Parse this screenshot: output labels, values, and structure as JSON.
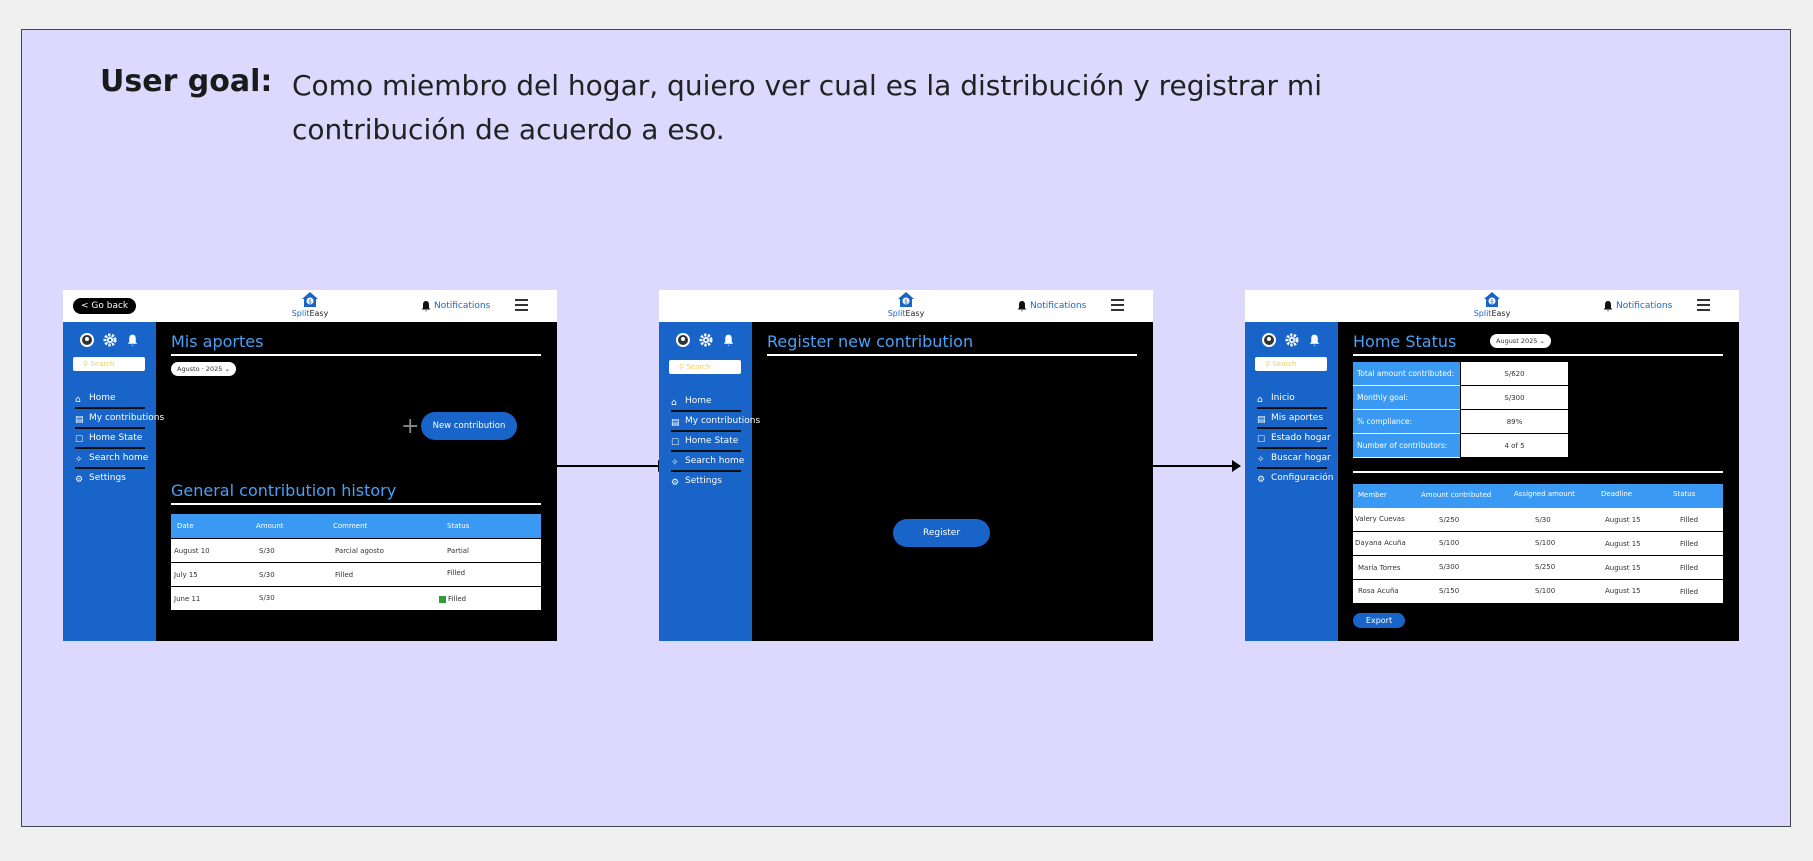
{
  "goal": {
    "label": "User goal:",
    "text": "Como miembro del hogar, quiero ver cual es la distribución y registrar mi contribución de acuerdo a eso."
  },
  "common": {
    "logo_a": "Split",
    "logo_b": "Easy",
    "notifications": "Notifications",
    "brand_blue": "#1864c8",
    "header_blue": "#3a99f2",
    "background": "#ddd8fd"
  },
  "screen1": {
    "go_back": "< Go back",
    "search_placeholder": "Search",
    "nav": [
      "Home",
      "My contributions",
      "Home State",
      "Search home",
      "Settings"
    ],
    "title": "Mis aportes",
    "month_selector": "Agusto · 2025",
    "new_contribution": "New contribution",
    "history_title": "General contribution history",
    "table": {
      "headers": [
        "Date",
        "Amount",
        "Comment",
        "Status"
      ],
      "rows": [
        [
          "August 10",
          "S/30",
          "Parcial agosto",
          "Partial"
        ],
        [
          "July 15",
          "S/30",
          "Filled",
          "Filled"
        ],
        [
          "June 11",
          "S/30",
          "",
          "Filled"
        ]
      ]
    }
  },
  "screen2": {
    "search_placeholder": "Search",
    "nav": [
      "Home",
      "My contributions",
      "Home State",
      "Search home",
      "Settings"
    ],
    "title": "Register new contribution",
    "register": "Register"
  },
  "screen3": {
    "search_placeholder": "Search",
    "nav": [
      "Inicio",
      "Mis aportes",
      "Estado hogar",
      "Buscar hogar",
      "Configuración"
    ],
    "title": "Home Status",
    "month_selector": "August 2025",
    "summary": [
      {
        "label": "Total amount contributed:",
        "value": "S/620"
      },
      {
        "label": "Monthly goal:",
        "value": "S/300"
      },
      {
        "label": "% compliance:",
        "value": "89%"
      },
      {
        "label": "Number of contributors:",
        "value": "4 of 5"
      }
    ],
    "table": {
      "headers": [
        "Member",
        "Amount contributed",
        "Assigned amount",
        "Deadline",
        "Status"
      ],
      "rows": [
        [
          "Valery Cuevas",
          "S/250",
          "S/30",
          "August 15",
          "Filled"
        ],
        [
          "Dayana Acuña",
          "S/100",
          "S/100",
          "August 15",
          "Filled"
        ],
        [
          "María Torres",
          "S/300",
          "S/250",
          "August 15",
          "Filled"
        ],
        [
          "Rosa Acuña",
          "S/150",
          "S/100",
          "August 15",
          "Filled"
        ]
      ]
    },
    "export": "Export"
  }
}
